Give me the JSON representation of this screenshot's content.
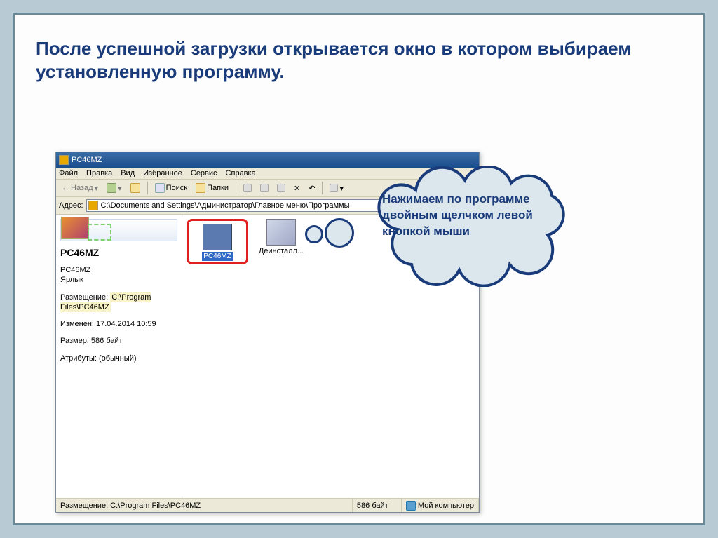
{
  "slide": {
    "title": "После успешной загрузки открывается окно в котором выбираем установленную программу."
  },
  "callout": {
    "text": "Нажимаем по программе двойным щелчком левой кнопкой мыши"
  },
  "window": {
    "title": "PC46MZ",
    "menu": {
      "file": "Файл",
      "edit": "Правка",
      "view": "Вид",
      "favorites": "Избранное",
      "tools": "Сервис",
      "help": "Справка"
    },
    "toolbar": {
      "back": "Назад",
      "search": "Поиск",
      "folders": "Папки"
    },
    "addressbar": {
      "label": "Адрес:",
      "value": "C:\\Documents and Settings\\Администратор\\Главное меню\\Программы"
    },
    "leftpane": {
      "title": "PC46MZ",
      "info_name": "PC46MZ",
      "info_type": "Ярлык",
      "info_location_label": "Размещение:",
      "info_location_value": "C:\\Program Files\\PC46MZ",
      "info_modified": "Изменен: 17.04.2014 10:59",
      "info_size": "Размер: 586 байт",
      "info_attrs": "Атрибуты: (обычный)"
    },
    "items": {
      "pc46mz": "PC46MZ",
      "uninstall": "Деинсталл..."
    },
    "statusbar": {
      "left": "Размещение: C:\\Program Files\\PC46MZ",
      "mid": "586 байт",
      "right": "Мой компьютер"
    }
  }
}
